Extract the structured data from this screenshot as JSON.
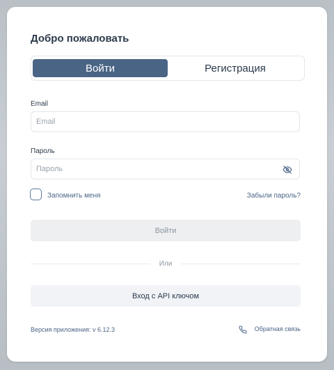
{
  "login": {
    "title": "Добро пожаловать",
    "tabs": [
      {
        "label": "Войти",
        "active": true
      },
      {
        "label": "Регистрация",
        "active": false
      }
    ],
    "email": {
      "label": "Email",
      "value": "",
      "placeholder": "Email"
    },
    "password": {
      "label": "Пароль",
      "value": "",
      "placeholder": "Пароль"
    },
    "remember_label": "Запомнить меня",
    "remember_checked": false,
    "forgot_label": "Забыли пароль?",
    "login_button": "Войти",
    "or_label": "Или",
    "api_button": "Вход с API ключом",
    "version_text": "Версия приложения: v 6.12.3",
    "feedback_label": "Обратная связь"
  },
  "icons": {
    "password_toggle": "eye-slash-icon",
    "feedback": "phone-icon"
  },
  "colors": {
    "accent": "#4a6485",
    "text": "#2c3a4b",
    "muted": "#8e969f",
    "border": "#e3e6ea",
    "disabled_bg": "#edeff1",
    "secondary_bg": "#f1f3f6"
  }
}
